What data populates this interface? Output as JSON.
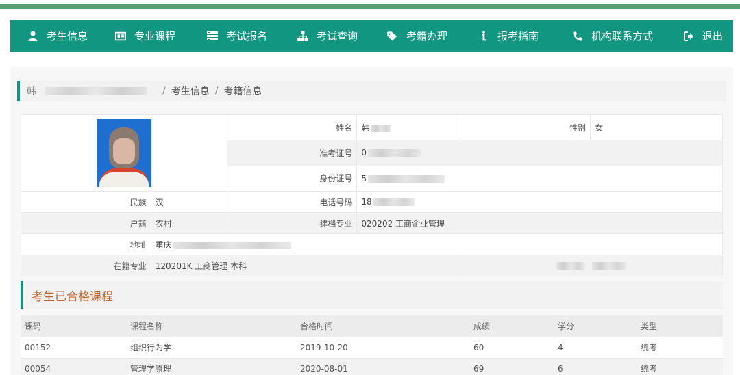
{
  "nav": {
    "items": [
      {
        "label": "考生信息",
        "icon": "user-icon"
      },
      {
        "label": "专业课程",
        "icon": "card-icon"
      },
      {
        "label": "考试报名",
        "icon": "list-icon"
      },
      {
        "label": "考试查询",
        "icon": "sitemap-icon"
      },
      {
        "label": "考籍办理",
        "icon": "tag-icon"
      },
      {
        "label": "报考指南",
        "icon": "info-icon"
      },
      {
        "label": "机构联系方式",
        "icon": "phone-icon"
      },
      {
        "label": "退出",
        "icon": "logout-icon"
      }
    ]
  },
  "breadcrumb": {
    "first": "韩",
    "level2": "考生信息",
    "level3": "考籍信息",
    "sep": "/"
  },
  "profile": {
    "name_label": "姓名",
    "name_value": "韩",
    "gender_label": "性别",
    "gender_value": "女",
    "exam_no_label": "准考证号",
    "exam_no_value": "0",
    "id_label": "身份证号",
    "id_value": "5",
    "ethnicity_label": "民族",
    "ethnicity_value": "汉",
    "phone_label": "电话号码",
    "phone_value": "18",
    "hukou_label": "户籍",
    "hukou_value": "农村",
    "archive_major_label": "建档专业",
    "archive_major_value": "020202 工商企业管理",
    "address_label": "地址",
    "address_value": "重庆",
    "enrolled_major_label": "在籍专业",
    "enrolled_major_value": "120201K 工商管理 本科"
  },
  "courses_section": {
    "title": "考生已合格课程",
    "headers": [
      "课码",
      "课程名称",
      "合格时间",
      "成绩",
      "学分",
      "类型"
    ],
    "rows": [
      [
        "00152",
        "组织行为学",
        "2019-10-20",
        "60",
        "4",
        "统考"
      ],
      [
        "00054",
        "管理学原理",
        "2020-08-01",
        "69",
        "6",
        "统考"
      ]
    ]
  },
  "colors": {
    "accent": "#119781",
    "stripe": "#5a9e74",
    "section_title": "#c0632a"
  }
}
